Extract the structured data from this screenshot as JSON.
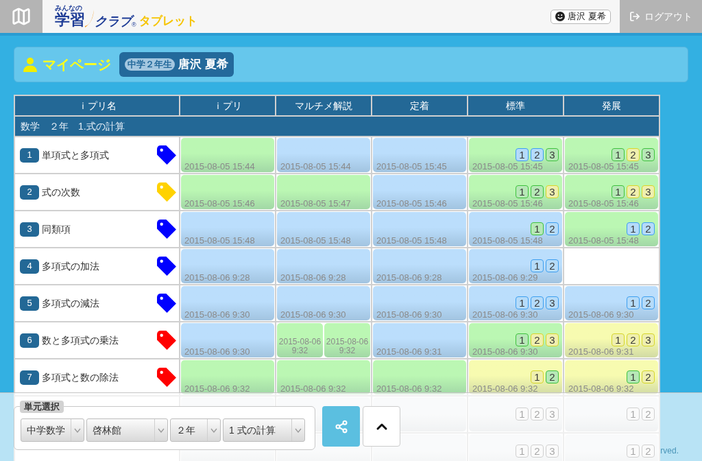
{
  "header": {
    "logo": {
      "tagline": "みんなの",
      "word": "学習",
      "club": "クラブ",
      "registered_mark": "®",
      "suffix": "タブレット"
    },
    "user_button": "唐沢 夏希",
    "logout_button": "ログアウト"
  },
  "page_title": {
    "title": "マイページ",
    "grade_badge": "中学２年生",
    "student_name": "唐沢 夏希"
  },
  "table": {
    "columns": [
      "ｉプリ名",
      "ｉプリ",
      "マルチメ解説",
      "定着",
      "標準",
      "発展"
    ],
    "section": "数学　２年　1.式の計算",
    "rows": [
      {
        "cells": [
          {
            "kind": "lesson",
            "number": "1",
            "name": "単項式と多項式",
            "tag": {
              "color": "#0000ff"
            }
          },
          {
            "kind": "tile",
            "color": "#bbf7b3",
            "date": "2015-08-05 15:44"
          },
          {
            "kind": "tile",
            "color": "#bbdefc",
            "date": "2015-08-05 15:44"
          },
          {
            "kind": "tile",
            "color": "#bbdefc",
            "date": "2015-08-05 15:45"
          },
          {
            "kind": "tile",
            "color": "#bbf7b3",
            "date": "2015-08-05 15:45",
            "levels": [
              {
                "label": "1",
                "color": "#3d9ff0"
              },
              {
                "label": "2",
                "color": "#3d9ff0"
              },
              {
                "label": "3",
                "color": "#3ec23e"
              }
            ]
          },
          {
            "kind": "tile",
            "color": "#bbf7b3",
            "date": "2015-08-05 15:45",
            "levels": [
              {
                "label": "1",
                "color": "#3ec23e"
              },
              {
                "label": "2",
                "color": "#d6d62a"
              },
              {
                "label": "3",
                "color": "#3ec23e"
              }
            ]
          }
        ]
      },
      {
        "cells": [
          {
            "kind": "lesson",
            "number": "2",
            "name": "式の次数",
            "tag": {
              "color": "#ffd200"
            }
          },
          {
            "kind": "tile",
            "color": "#bbf7b3",
            "date": "2015-08-05 15:46"
          },
          {
            "kind": "tile",
            "color": "#bbf7b3",
            "date": "2015-08-05 15:47"
          },
          {
            "kind": "tile",
            "color": "#bbdefc",
            "date": "2015-08-05 15:46"
          },
          {
            "kind": "tile",
            "color": "#bbf7b3",
            "date": "2015-08-05 15:46",
            "levels": [
              {
                "label": "1",
                "color": "#3ec23e"
              },
              {
                "label": "2",
                "color": "#3ec23e"
              },
              {
                "label": "3",
                "color": "#d6d62a"
              }
            ]
          },
          {
            "kind": "tile",
            "color": "#bbf7b3",
            "date": "2015-08-05 15:46",
            "levels": [
              {
                "label": "1",
                "color": "#3ec23e"
              },
              {
                "label": "2",
                "color": "#d6d62a"
              },
              {
                "label": "3",
                "color": "#d6d62a"
              }
            ]
          }
        ]
      },
      {
        "cells": [
          {
            "kind": "lesson",
            "number": "3",
            "name": "同類項",
            "tag": {
              "color": "#0000ff"
            }
          },
          {
            "kind": "tile",
            "color": "#bbdefc",
            "date": "2015-08-05 15:48"
          },
          {
            "kind": "tile",
            "color": "#bbdefc",
            "date": "2015-08-05 15:48"
          },
          {
            "kind": "tile",
            "color": "#bbdefc",
            "date": "2015-08-05 15:48"
          },
          {
            "kind": "tile",
            "color": "#bbdefc",
            "date": "2015-08-05 15:48",
            "levels": [
              {
                "label": "1",
                "color": "#3ec23e"
              },
              {
                "label": "2",
                "color": "#3d9ff0"
              }
            ]
          },
          {
            "kind": "tile",
            "color": "#bbf7b3",
            "date": "2015-08-05 15:48",
            "levels": [
              {
                "label": "1",
                "color": "#3d9ff0"
              },
              {
                "label": "2",
                "color": "#3d9ff0"
              }
            ]
          }
        ]
      },
      {
        "cells": [
          {
            "kind": "lesson",
            "number": "4",
            "name": "多項式の加法",
            "tag": {
              "color": "#0000ff"
            }
          },
          {
            "kind": "tile",
            "color": "#bbdefc",
            "date": "2015-08-06 9:28"
          },
          {
            "kind": "tile",
            "color": "#bbdefc",
            "date": "2015-08-06 9:28"
          },
          {
            "kind": "tile",
            "color": "#bbdefc",
            "date": "2015-08-06 9:28"
          },
          {
            "kind": "tile",
            "color": "#bbdefc",
            "date": "2015-08-06 9:29",
            "levels": [
              {
                "label": "1",
                "color": "#3d9ff0"
              },
              {
                "label": "2",
                "color": "#3d9ff0"
              }
            ]
          },
          {
            "kind": "empty"
          }
        ]
      },
      {
        "cells": [
          {
            "kind": "lesson",
            "number": "5",
            "name": "多項式の減法",
            "tag": {
              "color": "#0000ff"
            }
          },
          {
            "kind": "tile",
            "color": "#bbdefc",
            "date": "2015-08-06 9:30"
          },
          {
            "kind": "tile",
            "color": "#bbdefc",
            "date": "2015-08-06 9:30"
          },
          {
            "kind": "tile",
            "color": "#bbdefc",
            "date": "2015-08-06 9:30"
          },
          {
            "kind": "tile",
            "color": "#bbdefc",
            "date": "2015-08-06 9:30",
            "levels": [
              {
                "label": "1",
                "color": "#3d9ff0"
              },
              {
                "label": "2",
                "color": "#3d9ff0"
              },
              {
                "label": "3",
                "color": "#3d9ff0"
              }
            ]
          },
          {
            "kind": "tile",
            "color": "#bbdefc",
            "date": "2015-08-06 9:30",
            "levels": [
              {
                "label": "1",
                "color": "#3d9ff0"
              },
              {
                "label": "2",
                "color": "#3d9ff0"
              }
            ]
          }
        ]
      },
      {
        "cells": [
          {
            "kind": "lesson",
            "number": "6",
            "name": "数と多項式の乗法",
            "tag": {
              "color": "#ff0000"
            }
          },
          {
            "kind": "tile",
            "color": "#bbdefc",
            "date": "2015-08-06 9:30"
          },
          {
            "kind": "split",
            "parts": [
              {
                "color": "#bbf7b3",
                "date": "2015-08-06 9:32"
              },
              {
                "color": "#bbf7b3",
                "date": "2015-08-06 9:32"
              }
            ]
          },
          {
            "kind": "tile",
            "color": "#bbdefc",
            "date": "2015-08-06 9:31"
          },
          {
            "kind": "tile",
            "color": "#bbf7b3",
            "date": "2015-08-06 9:30",
            "levels": [
              {
                "label": "1",
                "color": "#3ec23e"
              },
              {
                "label": "2",
                "color": "#d6d62a"
              },
              {
                "label": "3",
                "color": "#d6d62a"
              }
            ]
          },
          {
            "kind": "tile",
            "color": "#f7fbb0",
            "date": "2015-08-06 9:31",
            "levels": [
              {
                "label": "1",
                "color": "#d6d62a"
              },
              {
                "label": "2",
                "color": "#d6d62a"
              },
              {
                "label": "3",
                "color": "#d6d62a"
              }
            ]
          }
        ]
      },
      {
        "cells": [
          {
            "kind": "lesson",
            "number": "7",
            "name": "多項式と数の除法",
            "tag": {
              "color": "#ff0000"
            }
          },
          {
            "kind": "tile",
            "color": "#bbf7b3",
            "date": "2015-08-06 9:32"
          },
          {
            "kind": "tile",
            "color": "#bbf7b3",
            "date": "2015-08-06 9:32"
          },
          {
            "kind": "tile",
            "color": "#bbf7b3",
            "date": "2015-08-06 9:32"
          },
          {
            "kind": "tile",
            "color": "#f7fbb0",
            "date": "2015-08-06 9:32",
            "levels": [
              {
                "label": "1",
                "color": "#d6d62a"
              },
              {
                "label": "2",
                "color": "#3ec23e"
              }
            ]
          },
          {
            "kind": "tile",
            "color": "#f7fbb0",
            "date": "2015-08-06 9:32",
            "levels": [
              {
                "label": "1",
                "color": "#3ec23e"
              },
              {
                "label": "2",
                "color": "#d6d62a"
              }
            ]
          }
        ]
      },
      {
        "cells": [
          {
            "kind": "lesson"
          },
          {
            "kind": "tile"
          },
          {
            "kind": "tile"
          },
          {
            "kind": "tile"
          },
          {
            "kind": "tile",
            "levels": [
              {
                "label": "1"
              },
              {
                "label": "2"
              },
              {
                "label": "3"
              }
            ]
          },
          {
            "kind": "tile",
            "levels": [
              {
                "label": "1"
              },
              {
                "label": "2"
              }
            ]
          }
        ]
      },
      {
        "cells": [
          {
            "kind": "lesson"
          },
          {
            "kind": "tile"
          },
          {
            "kind": "tile"
          },
          {
            "kind": "tile"
          },
          {
            "kind": "tile",
            "levels": [
              {
                "label": "1"
              },
              {
                "label": "2"
              },
              {
                "label": "3"
              }
            ]
          },
          {
            "kind": "tile",
            "levels": [
              {
                "label": "1"
              },
              {
                "label": "2"
              }
            ]
          }
        ]
      }
    ]
  },
  "unit_selector": {
    "legend": "単元選択",
    "selects": [
      {
        "value": "中学数学"
      },
      {
        "value": "啓林館"
      },
      {
        "value": "２年"
      },
      {
        "value": "1 式の計算"
      }
    ]
  },
  "footer_text": "rved."
}
